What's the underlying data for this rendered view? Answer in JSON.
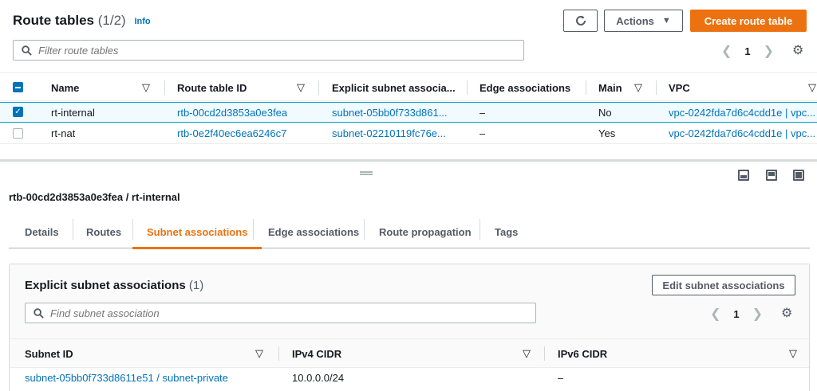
{
  "header": {
    "title": "Route tables",
    "count": "(1/2)",
    "info": "Info",
    "actions_label": "Actions",
    "create_label": "Create route table"
  },
  "filter": {
    "placeholder": "Filter route tables"
  },
  "pagination": {
    "page": "1"
  },
  "table": {
    "columns": [
      "Name",
      "Route table ID",
      "Explicit subnet associa...",
      "Edge associations",
      "Main",
      "VPC"
    ],
    "rows": [
      {
        "selected": true,
        "name": "rt-internal",
        "id": "rtb-00cd2d3853a0e3fea",
        "subnet": "subnet-05bb0f733d861...",
        "edge": "–",
        "main": "No",
        "vpc": "vpc-0242fda7d6c4cdd1e | vpc..."
      },
      {
        "selected": false,
        "name": "rt-nat",
        "id": "rtb-0e2f40ec6ea6246c7",
        "subnet": "subnet-02210119fc76e...",
        "edge": "–",
        "main": "Yes",
        "vpc": "vpc-0242fda7d6c4cdd1e | vpc..."
      }
    ]
  },
  "details": {
    "title": "rtb-00cd2d3853a0e3fea / rt-internal",
    "tabs": [
      "Details",
      "Routes",
      "Subnet associations",
      "Edge associations",
      "Route propagation",
      "Tags"
    ],
    "active_tab": "Subnet associations"
  },
  "subnet_panel": {
    "title": "Explicit subnet associations",
    "count": "(1)",
    "edit_label": "Edit subnet associations",
    "find_placeholder": "Find subnet association",
    "page": "1",
    "columns": [
      "Subnet ID",
      "IPv4 CIDR",
      "IPv6 CIDR"
    ],
    "rows": [
      {
        "subnet_id": "subnet-05bb0f733d8611e51 / subnet-private",
        "ipv4": "10.0.0.0/24",
        "ipv6": "–"
      }
    ]
  },
  "colors": {
    "primary": "#ec7211",
    "link": "#0073bb",
    "selected_row": "#f1faff"
  }
}
